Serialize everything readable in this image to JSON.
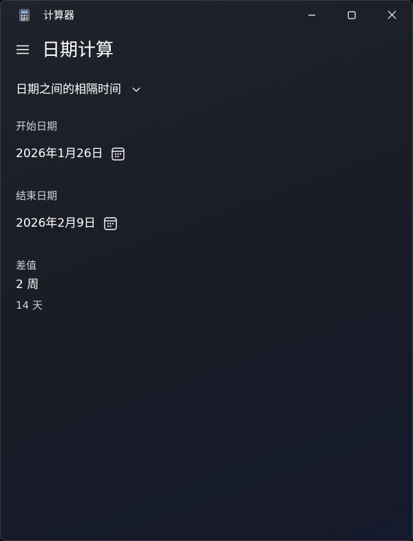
{
  "window": {
    "title": "计算器",
    "app_icon": "calculator-icon",
    "controls": [
      "minimize-icon",
      "maximize-icon",
      "close-icon"
    ]
  },
  "header": {
    "menu_icon": "hamburger-menu-icon",
    "title": "日期计算"
  },
  "mode": {
    "selected": "日期之间的相隔时间",
    "icon": "chevron-down-icon"
  },
  "start": {
    "label": "开始日期",
    "value": "2026年1月26日",
    "icon": "calendar-icon"
  },
  "end": {
    "label": "结束日期",
    "value": "2026年2月9日",
    "icon": "calendar-icon"
  },
  "difference": {
    "label": "差值",
    "weeks": "2 周",
    "days": "14 天"
  },
  "colors": {
    "background": "#1b1e27",
    "text": "#ffffff",
    "secondary_text": "#cfd1d6"
  }
}
